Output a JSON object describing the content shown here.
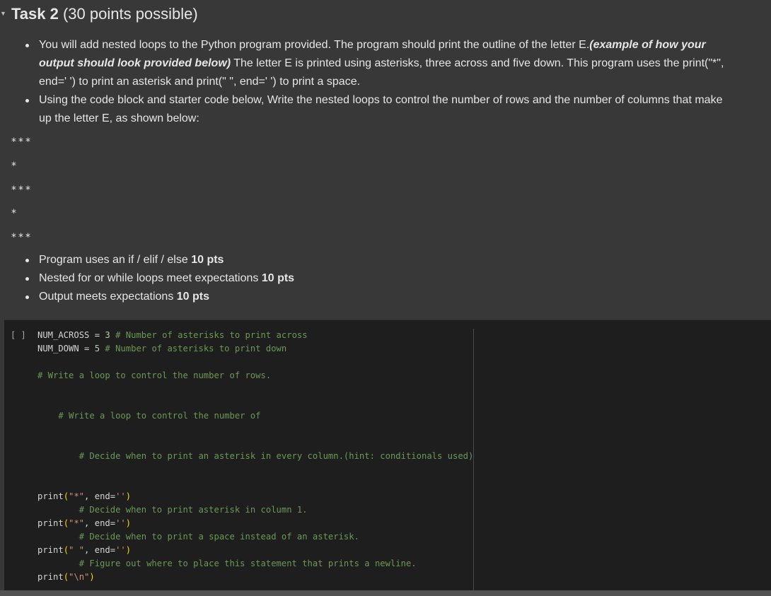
{
  "task": {
    "title_bold": "Task 2",
    "title_rest": " (30 points possible)"
  },
  "instructions": {
    "bullet1": {
      "text1": "You will add nested loops to the Python program provided. The program should print the outline of the letter E.",
      "emph": "(example of how your output should look provided below)",
      "text2": " The letter E is printed using asterisks, three across and five down. This program uses the print(\"*\", end=' ') to print an asterisk and print(\" \", end=' ') to print a space."
    },
    "bullet2": "Using the code block and starter code below, Write the nested loops to control the number of rows and the number of columns that make up the letter E, as shown below:"
  },
  "example_output": [
    "***",
    "*",
    "***",
    "*",
    "***"
  ],
  "rubric": [
    {
      "text": "Program uses an if / elif / else ",
      "points": "10 pts"
    },
    {
      "text": "Nested for or while loops meet expectations ",
      "points": "10 pts"
    },
    {
      "text": "Output meets expectations ",
      "points": "10 pts"
    }
  ],
  "code_cell": {
    "run_indicator": "[ ]",
    "lines": [
      {
        "indent": "",
        "code": "NUM_ACROSS = 3 ",
        "comment": "# Number of asterisks to print across"
      },
      {
        "indent": "",
        "code": "NUM_DOWN = 5 ",
        "comment": "# Number of asterisks to print down"
      },
      {
        "indent": "",
        "code": "",
        "comment": ""
      },
      {
        "indent": "",
        "code": "",
        "comment": "# Write a loop to control the number of rows."
      },
      {
        "indent": "",
        "code": "",
        "comment": ""
      },
      {
        "indent": "",
        "code": "",
        "comment": ""
      },
      {
        "indent": "    ",
        "code": "",
        "comment": "# Write a loop to control the number of"
      },
      {
        "indent": "",
        "code": "",
        "comment": ""
      },
      {
        "indent": "",
        "code": "",
        "comment": ""
      },
      {
        "indent": "        ",
        "code": "",
        "comment": "# Decide when to print an asterisk in every column.(hint: conditionals used)"
      },
      {
        "indent": "",
        "code": "",
        "comment": ""
      },
      {
        "indent": "",
        "code": "",
        "comment": ""
      },
      {
        "indent": "",
        "code": "print(\"*\", end='')",
        "comment": ""
      },
      {
        "indent": "        ",
        "code": "",
        "comment": "# Decide when to print asterisk in column 1."
      },
      {
        "indent": "",
        "code": "print(\"*\", end='')",
        "comment": ""
      },
      {
        "indent": "        ",
        "code": "",
        "comment": "# Decide when to print a space instead of an asterisk."
      },
      {
        "indent": "",
        "code": "print(\" \", end='')",
        "comment": ""
      },
      {
        "indent": "        ",
        "code": "",
        "comment": "# Figure out where to place this statement that prints a newline."
      },
      {
        "indent": "",
        "code": "print(\"\\n\")",
        "comment": ""
      }
    ]
  }
}
